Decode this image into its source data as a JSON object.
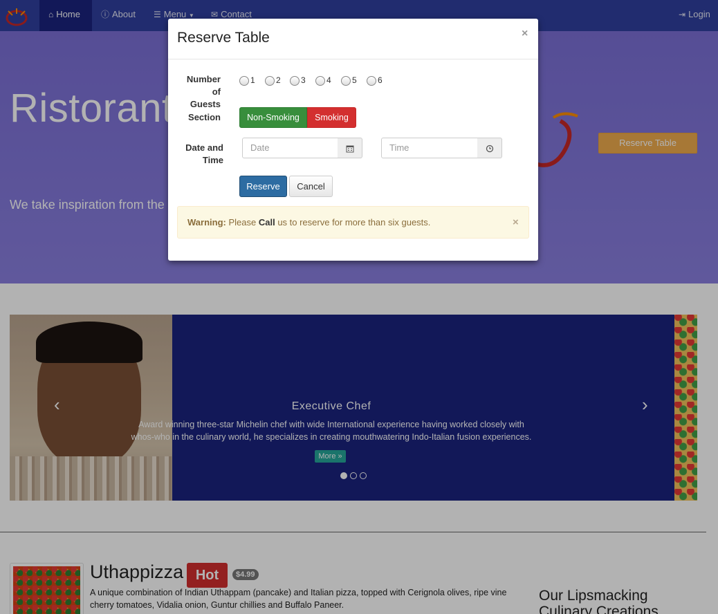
{
  "navbar": {
    "items": [
      {
        "label": "Home",
        "icon": "home-icon",
        "active": true
      },
      {
        "label": "About",
        "icon": "info-icon"
      },
      {
        "label": "Menu",
        "icon": "list-icon",
        "caret": true
      },
      {
        "label": "Contact",
        "icon": "envelope-icon"
      }
    ],
    "login_label": "Login"
  },
  "jumbotron": {
    "title": "Ristorante",
    "text": "We take inspiration from the experience. Our lipsmacking",
    "reserve_label": "Reserve Table"
  },
  "carousel": {
    "title": "Executive Chef",
    "text": "Award winning three-star Michelin chef with wide International experience having worked closely with whos-who in the culinary world, he specializes in creating mouthwatering Indo-Italian fusion experiences.",
    "more_label": "More »",
    "prev": "‹",
    "next": "›",
    "slide_count": 3,
    "active_slide": 1
  },
  "dish": {
    "name": "Uthappizza",
    "badge": "Hot",
    "price": "$4.99",
    "description": "A unique combination of Indian Uthappam (pancake) and Italian pizza, topped with Cerignola olives, ripe vine cherry tomatoes, Vidalia onion, Guntur chillies and Buffalo Paneer."
  },
  "sidebar": {
    "title": "Our Lipsmacking Culinary Creations"
  },
  "modal": {
    "title": "Reserve Table",
    "close": "×",
    "guests_label_1": "Number",
    "guests_label_2": "of Guests",
    "guest_options": [
      "1",
      "2",
      "3",
      "4",
      "5",
      "6"
    ],
    "section_label": "Section",
    "non_smoking_label": "Non-Smoking",
    "smoking_label": "Smoking",
    "datetime_label_1": "Date and",
    "datetime_label_2": "Time",
    "date_placeholder": "Date",
    "time_placeholder": "Time",
    "reserve_label": "Reserve",
    "cancel_label": "Cancel",
    "alert_strong": "Warning:",
    "alert_pre": "Please",
    "alert_call": "Call",
    "alert_post": "us to reserve for more than six guests.",
    "alert_close": "×"
  },
  "colors": {
    "navbar": "#303F9F",
    "jumbotron": "#7B6FD6",
    "carousel": "#1A237E",
    "warning_button": "#F0AD4E",
    "success": "#388E3C",
    "danger": "#D32F2F",
    "primary": "#2D6CA2"
  }
}
